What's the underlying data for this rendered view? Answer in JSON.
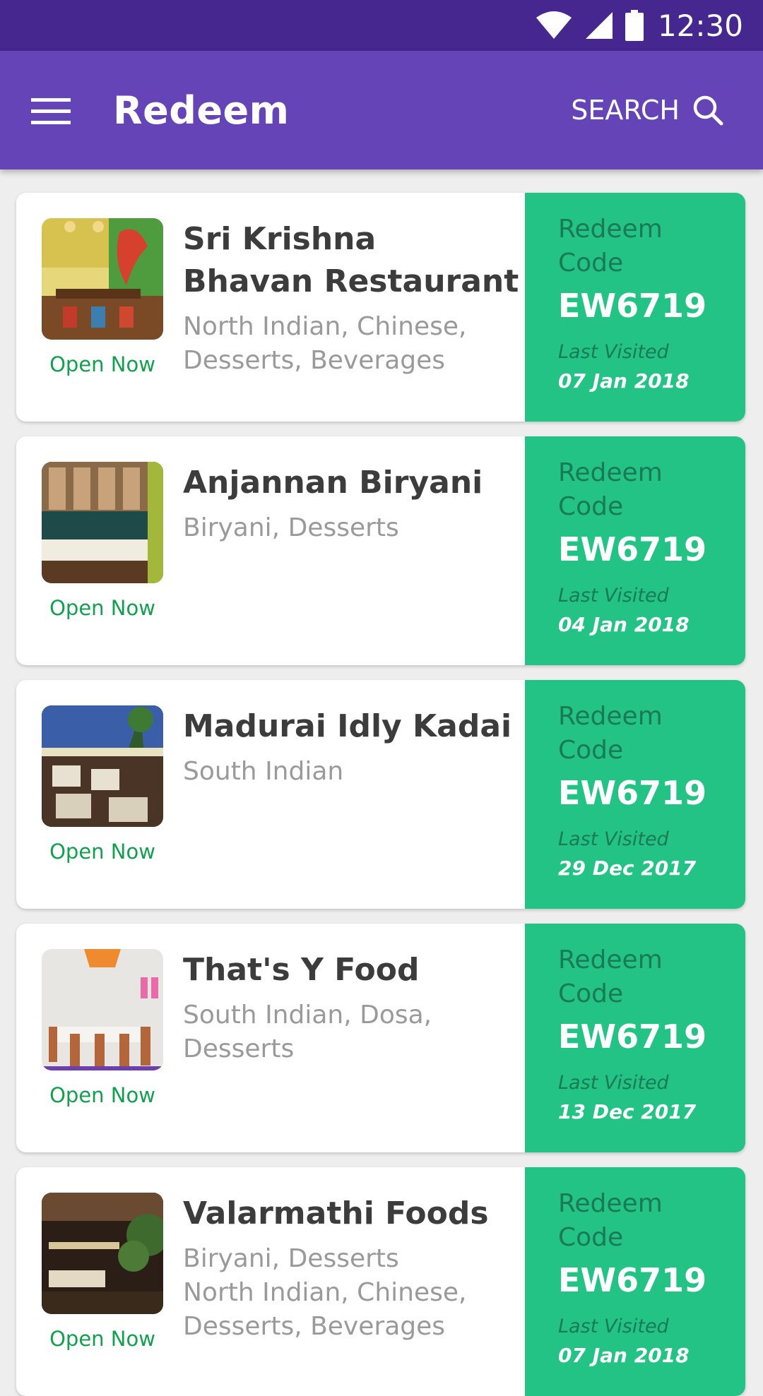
{
  "status_bar": {
    "time": "12:30",
    "icons": [
      "wifi-icon",
      "signal-icon",
      "battery-icon"
    ]
  },
  "app_bar": {
    "menu_icon": "menu-icon",
    "title": "Redeem",
    "search_label": "SEARCH",
    "search_icon": "search-icon"
  },
  "colors": {
    "status_bar": "#45278f",
    "app_bar": "#6444b6",
    "redeem_panel": "#23c386",
    "open_status": "#12a04f"
  },
  "restaurants": [
    {
      "name_lines": [
        "Sri Krishna",
        "Bhavan Restaurant"
      ],
      "cuisine_lines": [
        "North Indian, Chinese,",
        "Desserts, Beverages"
      ],
      "status": "Open Now",
      "code_label_1": "Redeem",
      "code_label_2": "Code",
      "code": "EW6719",
      "last_visited_label": "Last Visited",
      "last_visited_date": "07 Jan 2018"
    },
    {
      "name_lines": [
        "Anjannan Biryani",
        ""
      ],
      "cuisine_lines": [
        "Biryani, Desserts",
        ""
      ],
      "status": "Open Now",
      "code_label_1": "Redeem",
      "code_label_2": "Code",
      "code": "EW6719",
      "last_visited_label": "Last Visited",
      "last_visited_date": "04 Jan 2018"
    },
    {
      "name_lines": [
        "Madurai Idly Kadai",
        ""
      ],
      "cuisine_lines": [
        "South Indian",
        ""
      ],
      "status": "Open Now",
      "code_label_1": "Redeem",
      "code_label_2": "Code",
      "code": "EW6719",
      "last_visited_label": "Last Visited",
      "last_visited_date": "29 Dec 2017"
    },
    {
      "name_lines": [
        "That's Y Food",
        ""
      ],
      "cuisine_lines": [
        "South Indian, Dosa,",
        "Desserts"
      ],
      "status": "Open Now",
      "code_label_1": "Redeem",
      "code_label_2": "Code",
      "code": "EW6719",
      "last_visited_label": "Last Visited",
      "last_visited_date": "13 Dec 2017"
    },
    {
      "name_lines": [
        "Valarmathi Foods",
        ""
      ],
      "cuisine_lines": [
        "Biryani, Desserts",
        "North Indian, Chinese,",
        "Desserts, Beverages"
      ],
      "status": "Open Now",
      "code_label_1": "Redeem",
      "code_label_2": "Code",
      "code": "EW6719",
      "last_visited_label": "Last Visited",
      "last_visited_date": "07 Jan 2018"
    }
  ]
}
